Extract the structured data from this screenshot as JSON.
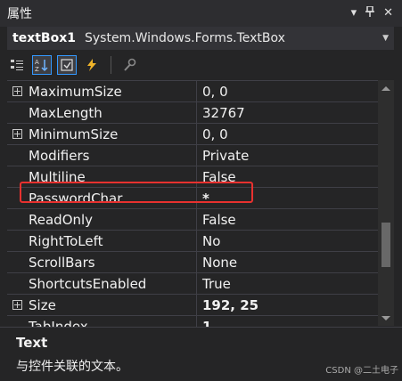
{
  "window": {
    "title": "属性"
  },
  "object_selector": {
    "name": "textBox1",
    "type": "System.Windows.Forms.TextBox"
  },
  "toolbar": {
    "buttons": [
      {
        "icon": "categorized-icon",
        "active": false
      },
      {
        "icon": "alphabetical-icon",
        "active": true
      },
      {
        "icon": "properties-icon",
        "active": true
      },
      {
        "icon": "events-icon",
        "active": false
      },
      {
        "icon": "property-pages-icon",
        "active": false
      }
    ]
  },
  "properties": [
    {
      "name": "MaximumSize",
      "value": "0, 0",
      "expandable": true,
      "bold": false
    },
    {
      "name": "MaxLength",
      "value": "32767",
      "expandable": false,
      "bold": false
    },
    {
      "name": "MinimumSize",
      "value": "0, 0",
      "expandable": true,
      "bold": false
    },
    {
      "name": "Modifiers",
      "value": "Private",
      "expandable": false,
      "bold": false
    },
    {
      "name": "Multiline",
      "value": "False",
      "expandable": false,
      "bold": false
    },
    {
      "name": "PasswordChar",
      "value": "*",
      "expandable": false,
      "bold": true
    },
    {
      "name": "ReadOnly",
      "value": "False",
      "expandable": false,
      "bold": false
    },
    {
      "name": "RightToLeft",
      "value": "No",
      "expandable": false,
      "bold": false
    },
    {
      "name": "ScrollBars",
      "value": "None",
      "expandable": false,
      "bold": false
    },
    {
      "name": "ShortcutsEnabled",
      "value": "True",
      "expandable": false,
      "bold": false
    },
    {
      "name": "Size",
      "value": "192, 25",
      "expandable": true,
      "bold": true
    },
    {
      "name": "TabIndex",
      "value": "1",
      "expandable": false,
      "bold": true
    }
  ],
  "description": {
    "title": "Text",
    "text": "与控件关联的文本。"
  },
  "watermark": "CSDN @二土电子",
  "colors": {
    "highlight": "#e8312f",
    "selected_border": "#3399ff",
    "background": "#252526"
  }
}
